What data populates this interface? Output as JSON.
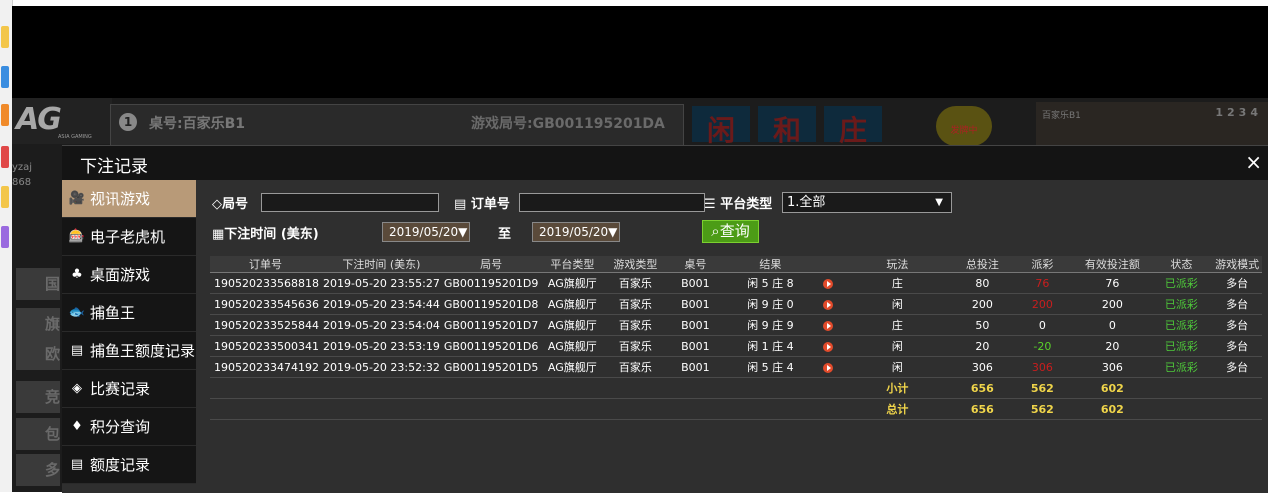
{
  "game": {
    "logo": "AG",
    "logo_tag": "ASIA GAMING",
    "table_num": "1",
    "table_label": "桌号:百家乐B1",
    "round_label": "游戏局号:GB001195201DA",
    "bet_player": "闲",
    "bet_tie": "和",
    "bet_banker": "庄",
    "coin_text": "发牌中",
    "right_table": "百家乐B1",
    "right_nums": "1234",
    "user": "yzaj",
    "balance": "868",
    "lobby_items": [
      "国",
      "旗",
      "欧",
      "竞",
      "包",
      "多"
    ]
  },
  "modal": {
    "title": "下注记录",
    "close": "×",
    "menu": [
      {
        "label": "视讯游戏",
        "icon": "video-icon",
        "glyph": "🎥",
        "active": true
      },
      {
        "label": "电子老虎机",
        "icon": "slot-icon",
        "glyph": "🎰",
        "active": false
      },
      {
        "label": "桌面游戏",
        "icon": "cards-icon",
        "glyph": "♣",
        "active": false
      },
      {
        "label": "捕鱼王",
        "icon": "fish-icon",
        "glyph": "🐟",
        "active": false
      },
      {
        "label": "捕鱼王额度记录",
        "icon": "doc-icon",
        "glyph": "▤",
        "active": false
      },
      {
        "label": "比赛记录",
        "icon": "diamond-icon",
        "glyph": "◈",
        "active": false
      },
      {
        "label": "积分查询",
        "icon": "gem-icon",
        "glyph": "♦",
        "active": false
      },
      {
        "label": "额度记录",
        "icon": "note-icon",
        "glyph": "▤",
        "active": false
      }
    ],
    "filters": {
      "round_label": "局号",
      "round_value": "",
      "order_label": "订单号",
      "order_value": "",
      "platform_label": "平台类型",
      "platform_value": "1.全部",
      "time_label": "下注时间 (美东)",
      "date_from": "2019/05/20",
      "to_label": "至",
      "date_to": "2019/05/20",
      "query": "查询"
    },
    "table": {
      "headers": [
        "订单号",
        "下注时间 (美东)",
        "局号",
        "平台类型",
        "游戏类型",
        "桌号",
        "结果",
        "",
        "玩法",
        "总投注",
        "派彩",
        "有效投注额",
        "状态",
        "游戏模式"
      ],
      "rows": [
        {
          "order": "190520233568818",
          "time": "2019-05-20 23:55:27",
          "round": "GB001195201D9",
          "platform": "AG旗舰厅",
          "game": "百家乐",
          "table": "B001",
          "result": "闲 5 庄 8",
          "play": "庄",
          "bet": "80",
          "payout": "76",
          "payout_color": "#c81e1e",
          "valid": "76",
          "status": "已派彩",
          "mode": "多台"
        },
        {
          "order": "190520233545636",
          "time": "2019-05-20 23:54:44",
          "round": "GB001195201D8",
          "platform": "AG旗舰厅",
          "game": "百家乐",
          "table": "B001",
          "result": "闲 9 庄 0",
          "play": "闲",
          "bet": "200",
          "payout": "200",
          "payout_color": "#c81e1e",
          "valid": "200",
          "status": "已派彩",
          "mode": "多台"
        },
        {
          "order": "190520233525844",
          "time": "2019-05-20 23:54:04",
          "round": "GB001195201D7",
          "platform": "AG旗舰厅",
          "game": "百家乐",
          "table": "B001",
          "result": "闲 9 庄 9",
          "play": "庄",
          "bet": "50",
          "payout": "0",
          "payout_color": "#ffffff",
          "valid": "0",
          "status": "已派彩",
          "mode": "多台"
        },
        {
          "order": "190520233500341",
          "time": "2019-05-20 23:53:19",
          "round": "GB001195201D6",
          "platform": "AG旗舰厅",
          "game": "百家乐",
          "table": "B001",
          "result": "闲 1 庄 4",
          "play": "闲",
          "bet": "20",
          "payout": "-20",
          "payout_color": "#5ad02a",
          "valid": "20",
          "status": "已派彩",
          "mode": "多台"
        },
        {
          "order": "190520233474192",
          "time": "2019-05-20 23:52:32",
          "round": "GB001195201D5",
          "platform": "AG旗舰厅",
          "game": "百家乐",
          "table": "B001",
          "result": "闲 5 庄 4",
          "play": "闲",
          "bet": "306",
          "payout": "306",
          "payout_color": "#c81e1e",
          "valid": "306",
          "status": "已派彩",
          "mode": "多台"
        }
      ],
      "subtotal": {
        "label": "小计",
        "bet": "656",
        "payout": "562",
        "valid": "602"
      },
      "total": {
        "label": "总计",
        "bet": "656",
        "payout": "562",
        "valid": "602"
      },
      "status_color": "#4ec83a",
      "sum_color": "#f0d54a"
    }
  }
}
